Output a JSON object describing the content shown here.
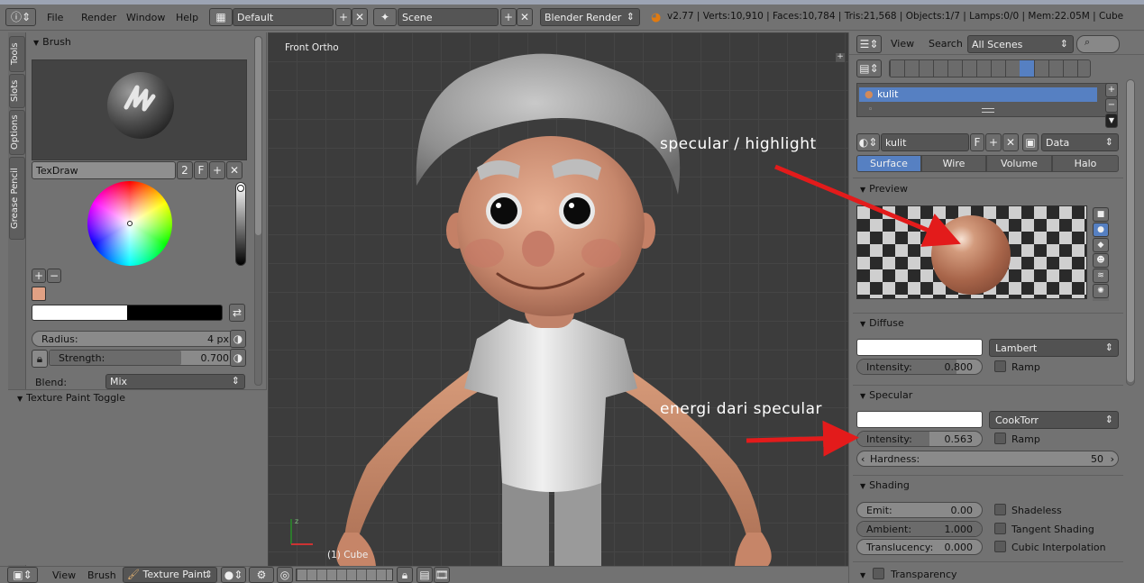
{
  "header": {
    "menus": [
      "File",
      "Render",
      "Window",
      "Help"
    ],
    "layout": "Default",
    "scene": "Scene",
    "engine": "Blender Render",
    "stats": "v2.77 | Verts:10,910 | Faces:10,784 | Tris:21,568 | Objects:1/7 | Lamps:0/0 | Mem:22.05M | Cube"
  },
  "toolshelf": {
    "tabs": [
      "Tools",
      "Slots",
      "Options",
      "Grease Pencil"
    ],
    "brush_panel": "Brush",
    "brush_name": "TexDraw",
    "brush_users": "2",
    "brush_fake": "F",
    "radius": {
      "label": "Radius:",
      "value": "4 px"
    },
    "strength": {
      "label": "Strength:",
      "value": "0.700"
    },
    "blend": {
      "label": "Blend:",
      "value": "Mix"
    },
    "texture_panel": "Texture Paint Toggle"
  },
  "viewport": {
    "view_label": "Front Ortho",
    "object_label": "(1) Cube"
  },
  "bottombar": {
    "view": "View",
    "brush": "Brush",
    "mode": "Texture Paint"
  },
  "properties": {
    "header": {
      "view": "View",
      "search": "Search",
      "scenes": "All Scenes"
    },
    "material_slot": "kulit",
    "material_name": "kulit",
    "material_fake": "F",
    "data_mode": "Data",
    "tabs": [
      "Surface",
      "Wire",
      "Volume",
      "Halo"
    ],
    "preview": "Preview",
    "diffuse": {
      "title": "Diffuse",
      "shader": "Lambert",
      "intensity_label": "Intensity:",
      "intensity": "0.800",
      "ramp": "Ramp"
    },
    "specular": {
      "title": "Specular",
      "shader": "CookTorr",
      "intensity_label": "Intensity:",
      "intensity": "0.563",
      "ramp": "Ramp",
      "hardness_label": "Hardness:",
      "hardness": "50"
    },
    "shading": {
      "title": "Shading",
      "emit_label": "Emit:",
      "emit": "0.00",
      "ambient_label": "Ambient:",
      "ambient": "1.000",
      "translucency_label": "Translucency:",
      "translucency": "0.000",
      "shadeless": "Shadeless",
      "tangent": "Tangent Shading",
      "cubic": "Cubic Interpolation"
    },
    "transparency": "Transparency"
  },
  "annotations": {
    "highlight": "specular  /  highlight",
    "energy": "energi  dari  specular"
  },
  "colors": {
    "brush_color": "#e1a184",
    "active_tab": "#5680c2",
    "arrow": "#e31b1b",
    "skin": "#d79b7a"
  }
}
